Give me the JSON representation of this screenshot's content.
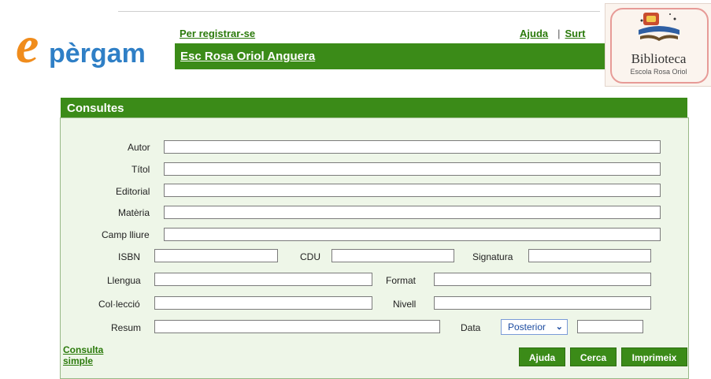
{
  "header": {
    "logo_text": "epèrgam",
    "register_link": "Per registrar-se",
    "help_link": "Ajuda",
    "separator": "|",
    "exit_link": "Surt",
    "school_name": "Esc Rosa Oriol Anguera"
  },
  "badge": {
    "title": "Biblioteca",
    "subtitle": "Escola Rosa Oriol"
  },
  "panel": {
    "title": "Consultes",
    "fields": {
      "autor": "Autor",
      "titol": "Títol",
      "editorial": "Editorial",
      "materia": "Matèria",
      "camp_lliure": "Camp lliure",
      "isbn": "ISBN",
      "cdu": "CDU",
      "signatura": "Signatura",
      "llengua": "Llengua",
      "format": "Format",
      "colleccio": "Col·lecció",
      "nivell": "Nivell",
      "resum": "Resum",
      "data": "Data"
    },
    "date_select": {
      "selected": "Posterior"
    }
  },
  "footer": {
    "simple_line1": "Consulta",
    "simple_line2": "simple",
    "help_button": "Ajuda",
    "search_button": "Cerca",
    "print_button": "Imprimeix"
  },
  "colors": {
    "accent_green": "#3b8b18",
    "panel_bg": "#eef6e8",
    "logo_orange": "#f08c1c"
  }
}
